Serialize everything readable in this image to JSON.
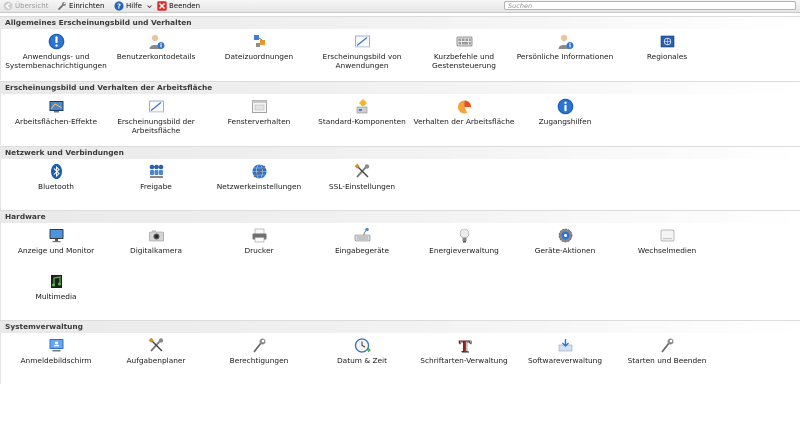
{
  "toolbar": {
    "overview": {
      "label": "Übersicht",
      "icon": "arrow-back-icon"
    },
    "configure": {
      "label": "Einrichten",
      "icon": "wrench-icon"
    },
    "help": {
      "label": "Hilfe",
      "icon": "help-icon"
    },
    "quit": {
      "label": "Beenden",
      "icon": "quit-icon"
    }
  },
  "search": {
    "placeholder": "Suchen",
    "value": ""
  },
  "sections": {
    "general": {
      "title": "Allgemeines Erscheinungsbild und Verhalten",
      "items": [
        {
          "label": "Anwendungs- und\nSystembenachrichtigungen",
          "icon": "notification-icon"
        },
        {
          "label": "Benutzerkontodetails",
          "icon": "user-info-icon"
        },
        {
          "label": "Dateizuordnungen",
          "icon": "file-associations-icon"
        },
        {
          "label": "Erscheinungsbild von\nAnwendungen",
          "icon": "appearance-icon"
        },
        {
          "label": "Kurzbefehle und\nGestensteuerung",
          "icon": "keyboard-icon"
        },
        {
          "label": "Persönliche Informationen",
          "icon": "personal-info-icon"
        },
        {
          "label": "Regionales",
          "icon": "flag-icon"
        }
      ]
    },
    "workspace": {
      "title": "Erscheinungsbild und Verhalten der Arbeitsfläche",
      "items": [
        {
          "label": "Arbeitsflächen-Effekte",
          "icon": "desktop-effects-icon"
        },
        {
          "label": "Erscheinungsbild der\nArbeitsfläche",
          "icon": "workspace-appearance-icon"
        },
        {
          "label": "Fensterverhalten",
          "icon": "window-icon"
        },
        {
          "label": "Standard-Komponenten",
          "icon": "default-components-icon"
        },
        {
          "label": "Verhalten der Arbeitsfläche",
          "icon": "pie-chart-icon"
        },
        {
          "label": "Zugangshilfen",
          "icon": "accessibility-icon"
        }
      ]
    },
    "network": {
      "title": "Netzwerk und Verbindungen",
      "items": [
        {
          "label": "Bluetooth",
          "icon": "bluetooth-icon"
        },
        {
          "label": "Freigabe",
          "icon": "sharing-icon"
        },
        {
          "label": "Netzwerkeinstellungen",
          "icon": "network-globe-icon"
        },
        {
          "label": "SSL-Einstellungen",
          "icon": "tools-icon"
        }
      ]
    },
    "hardware": {
      "title": "Hardware",
      "items": [
        {
          "label": "Anzeige und Monitor",
          "icon": "monitor-icon"
        },
        {
          "label": "Digitalkamera",
          "icon": "camera-icon"
        },
        {
          "label": "Drucker",
          "icon": "printer-icon"
        },
        {
          "label": "Eingabegeräte",
          "icon": "input-devices-icon"
        },
        {
          "label": "Energieverwaltung",
          "icon": "lightbulb-icon"
        },
        {
          "label": "Geräte-Aktionen",
          "icon": "device-actions-icon"
        },
        {
          "label": "Wechselmedien",
          "icon": "removable-media-icon"
        },
        {
          "label": "Multimedia",
          "icon": "multimedia-icon"
        }
      ]
    },
    "system": {
      "title": "Systemverwaltung",
      "items": [
        {
          "label": "Anmeldebildschirm",
          "icon": "login-screen-icon"
        },
        {
          "label": "Aufgabenplaner",
          "icon": "task-scheduler-icon"
        },
        {
          "label": "Berechtigungen",
          "icon": "permissions-icon"
        },
        {
          "label": "Datum & Zeit",
          "icon": "clock-icon"
        },
        {
          "label": "Schriftarten-Verwaltung",
          "icon": "font-icon"
        },
        {
          "label": "Softwareverwaltung",
          "icon": "software-icon"
        },
        {
          "label": "Starten und Beenden",
          "icon": "startup-icon"
        }
      ]
    }
  }
}
